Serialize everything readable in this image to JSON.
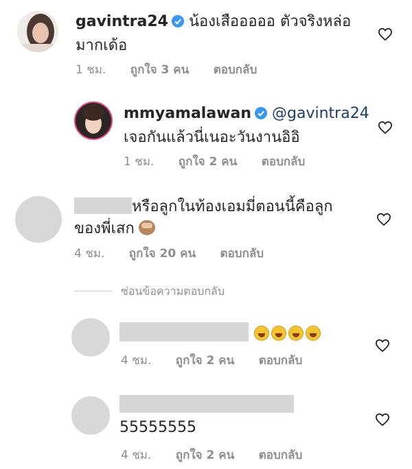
{
  "comments": [
    {
      "username": "gavintra24",
      "text_line1": "น้องเสือออออ ตัวจริงหล่อ",
      "text_line2": "มากเด้อ",
      "time": "1 ชม.",
      "likes": "ถูกใจ 3 คน",
      "reply": "ตอบกลับ"
    },
    {
      "username": "mmyamalawan",
      "mention": "@gavintra24",
      "text_line2": "เจอกันแล้วนี่เนอะวันงานอิอิ",
      "time": "1 ชม.",
      "likes": "ถูกใจ 2 คน",
      "reply": "ตอบกลับ"
    },
    {
      "text_line1": "หรือลูกในท้องเอมมี่ตอนนี้คือลูก",
      "text_line2": "ของพี่เสก",
      "time": "4 ชม.",
      "likes": "ถูกใจ 20 คน",
      "reply": "ตอบกลับ"
    },
    {
      "time": "4 ชม.",
      "likes": "ถูกใจ 2 คน",
      "reply": "ตอบกลับ"
    },
    {
      "text_line2": "55555555",
      "time": "4 ชม.",
      "likes": "ถูกใจ 2 คน",
      "reply": "ตอบกลับ"
    }
  ],
  "hide_replies": "ซ่อนข้อความตอบกลับ",
  "icons": {
    "verified": "verified-badge-icon",
    "like": "heart-outline-icon",
    "laughing": "laughing-emoji-icon",
    "monkey": "see-no-evil-monkey-emoji-icon"
  },
  "colors": {
    "verified": "#3897f0",
    "meta": "#8e8e8e",
    "mention": "#1a3d6e"
  }
}
